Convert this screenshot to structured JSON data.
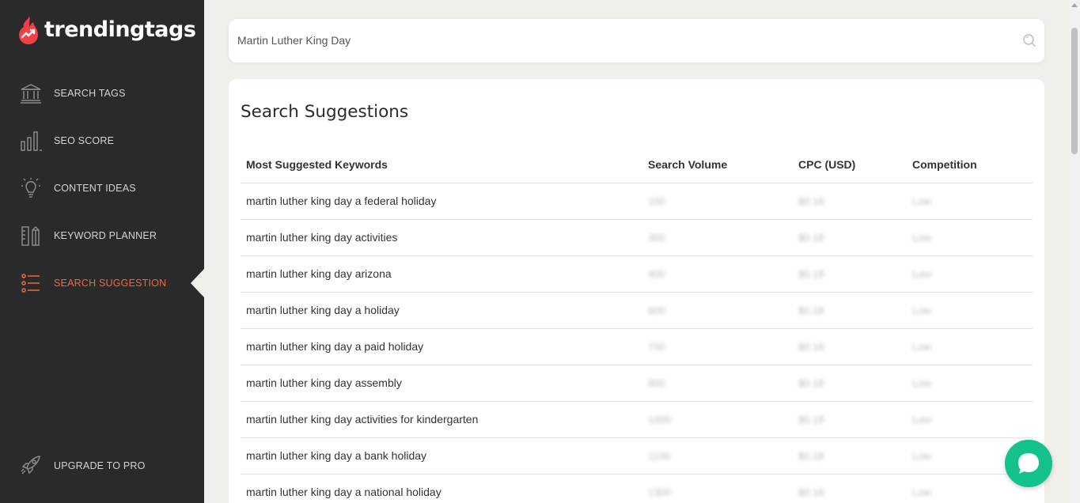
{
  "brand": {
    "name": "trendingtags",
    "accent": "#f0693c",
    "logo_color": "#f23d4a"
  },
  "sidebar": {
    "items": [
      {
        "label": "SEARCH TAGS",
        "icon": "bank-icon"
      },
      {
        "label": "SEO SCORE",
        "icon": "bar-chart-icon"
      },
      {
        "label": "CONTENT IDEAS",
        "icon": "lightbulb-icon"
      },
      {
        "label": "KEYWORD PLANNER",
        "icon": "ruler-pencil-icon"
      },
      {
        "label": "SEARCH SUGGESTION",
        "icon": "list-icon",
        "active": true
      }
    ],
    "upgrade": {
      "label": "UPGRADE TO PRO",
      "icon": "rocket-icon"
    }
  },
  "search": {
    "value": "Martin Luther King Day"
  },
  "suggestions": {
    "title": "Search Suggestions",
    "columns": [
      "Most Suggested Keywords",
      "Search Volume",
      "CPC (USD)",
      "Competition"
    ],
    "rows": [
      {
        "keyword": "martin luther king day a federal holiday",
        "volume": "100",
        "cpc": "$0.18",
        "competition": "Low"
      },
      {
        "keyword": "martin luther king day activities",
        "volume": "300",
        "cpc": "$0.18",
        "competition": "Low"
      },
      {
        "keyword": "martin luther king day arizona",
        "volume": "400",
        "cpc": "$0.18",
        "competition": "Low"
      },
      {
        "keyword": "martin luther king day a holiday",
        "volume": "600",
        "cpc": "$0.18",
        "competition": "Low"
      },
      {
        "keyword": "martin luther king day a paid holiday",
        "volume": "700",
        "cpc": "$0.18",
        "competition": "Low"
      },
      {
        "keyword": "martin luther king day assembly",
        "volume": "800",
        "cpc": "$0.18",
        "competition": "Low"
      },
      {
        "keyword": "martin luther king day activities for kindergarten",
        "volume": "1000",
        "cpc": "$0.18",
        "competition": "Low"
      },
      {
        "keyword": "martin luther king day a bank holiday",
        "volume": "1100",
        "cpc": "$0.18",
        "competition": "Low"
      },
      {
        "keyword": "martin luther king day a national holiday",
        "volume": "1300",
        "cpc": "$0.18",
        "competition": "Low"
      }
    ]
  },
  "chat": {
    "icon": "chat-bubble-icon",
    "color": "#13c28a"
  }
}
